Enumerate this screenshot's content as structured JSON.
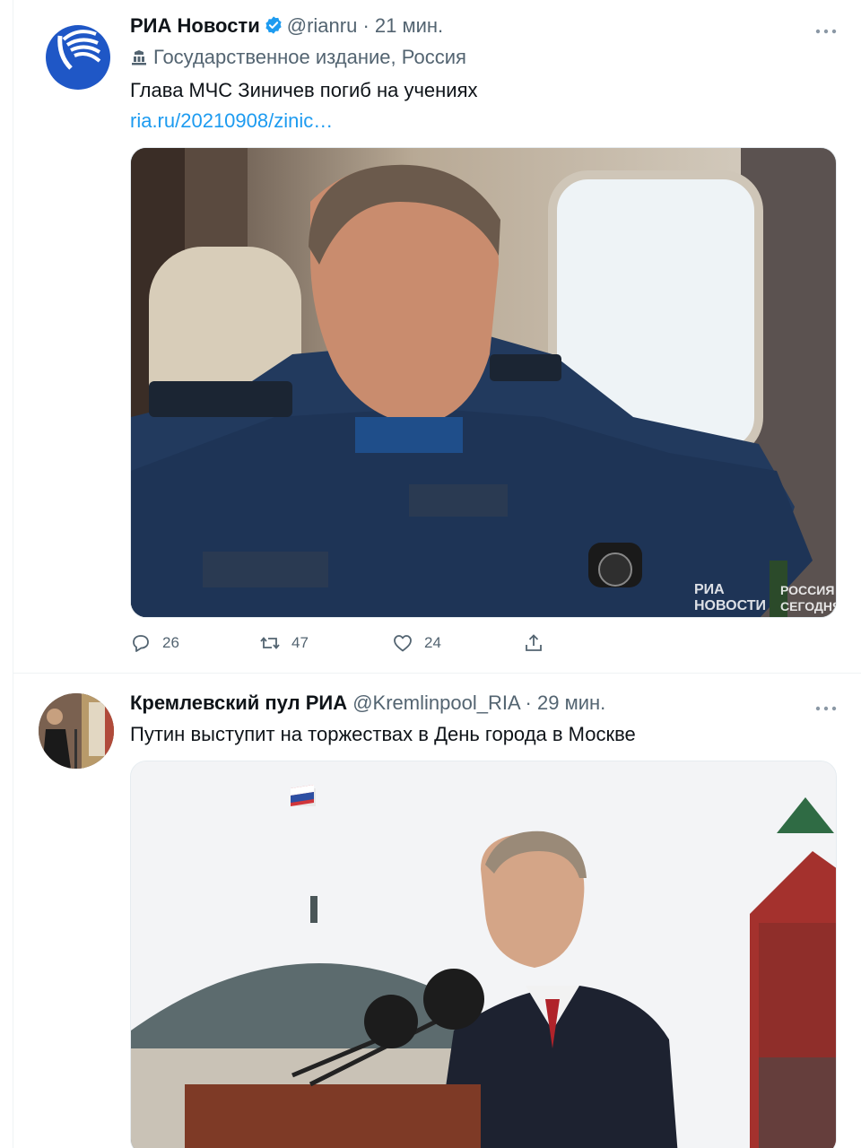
{
  "tweets": [
    {
      "author_name": "РИА Новости",
      "author_handle": "@rianru",
      "separator": "·",
      "time": "21 мин.",
      "account_label": "Государственное издание, Россия",
      "text": "Глава МЧС Зиничев погиб на учениях",
      "link": "ria.ru/20210908/zinic…",
      "media_watermark": [
        "РИА",
        "НОВОСТИ"
      ],
      "media_watermark_2": [
        "РОССИЯ",
        "СЕГОДНЯ"
      ],
      "stats": {
        "replies": "26",
        "retweets": "47",
        "likes": "24"
      }
    },
    {
      "author_name": "Кремлевский пул РИА",
      "author_handle": "@Kremlinpool_RIA",
      "separator": "·",
      "time": "29 мин.",
      "text": "Путин выступит на торжествах в День города в Москве"
    }
  ],
  "icons": {
    "verified": "verified-badge-icon",
    "more": "more-dots-icon",
    "label": "government-building-icon",
    "reply": "reply-icon",
    "retweet": "retweet-icon",
    "like": "heart-icon",
    "share": "share-icon"
  },
  "colors": {
    "link": "#1d9bf0",
    "verified": "#1d9bf0",
    "secondary_text": "#536471",
    "primary_text": "#0f1419"
  }
}
